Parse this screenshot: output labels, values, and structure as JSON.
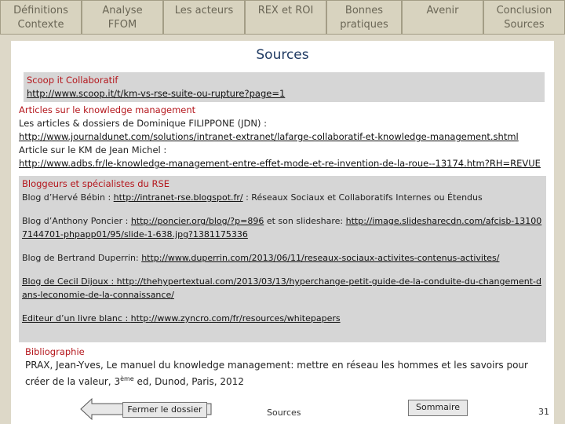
{
  "tabs": [
    {
      "line1": "Définitions",
      "line2": "Contexte"
    },
    {
      "line1": "Analyse",
      "line2": "FFOM"
    },
    {
      "line1": "Les acteurs",
      "line2": ""
    },
    {
      "line1": "REX et ROI",
      "line2": ""
    },
    {
      "line1": "Bonnes",
      "line2": "pratiques"
    },
    {
      "line1": "Avenir",
      "line2": ""
    },
    {
      "line1": "Conclusion",
      "line2": "Sources"
    }
  ],
  "slide": {
    "title": "Sources",
    "scoop": {
      "heading": "Scoop it Collaboratif",
      "link": "http://www.scoop.it/t/km-vs-rse-suite-ou-rupture?page=1"
    },
    "articles": {
      "heading": "Articles sur le knowledge management",
      "line1": "Les articles & dossiers de Dominique FILIPPONE (JDN) :",
      "link1": "http://www.journaldunet.com/solutions/intranet-extranet/lafarge-collaboratif-et-knowledge-management.shtml",
      "line2": "Article sur le KM de Jean Michel :",
      "link2": "http://www.adbs.fr/le-knowledge-management-entre-effet-mode-et-re-invention-de-la-roue--13174.htm?RH=REVUE"
    },
    "bloggers": {
      "heading": "Bloggeurs et spécialistes du RSE",
      "herve_prefix": "Blog d’Hervé Bébin : ",
      "herve_link": "http://intranet-rse.blogspot.fr/",
      "herve_suffix": " : Réseaux Sociaux et Collaboratifs Internes ou Étendus",
      "anthony_prefix": "Blog d’Anthony Poncier : ",
      "anthony_link": "http://poncier.org/blog/?p=896",
      "anthony_mid": " et son slideshare: ",
      "anthony_link2": "http://image.slidesharecdn.com/afcisb-131007144701-phpapp01/95/slide-1-638.jpg?1381175336",
      "bertrand_prefix": "Blog de Bertrand Duperrin: ",
      "bertrand_link": "http://www.duperrin.com/2013/06/11/reseaux-sociaux-activites-contenus-activites/",
      "cecil_prefix": "Blog de Cecil Dijoux : ",
      "cecil_link": "http://thehypertextual.com/2013/03/13/hyperchange-petit-guide-de-la-conduite-du-changement-dans-leconomie-de-la-connaissance/",
      "editeur_prefix": "Editeur d’un livre blanc : ",
      "editeur_link": "http://www.zyncro.com/fr/resources/whitepapers"
    },
    "biblio": {
      "heading": "Bibliographie",
      "text_before_sup": "PRAX, Jean-Yves, Le manuel du knowledge management: mettre en réseau les hommes et les savoirs pour créer de la valeur, 3",
      "sup": "ème",
      "text_after_sup": " ed, Dunod, Paris, 2012"
    }
  },
  "footer": {
    "close_label": "Fermer le dossier",
    "section": "Sources",
    "summary_label": "Sommaire",
    "page_number": "31"
  },
  "colors": {
    "heading_red": "#b4161c",
    "title_blue": "#1f3a62",
    "tab_bg": "#d8d3bf"
  }
}
